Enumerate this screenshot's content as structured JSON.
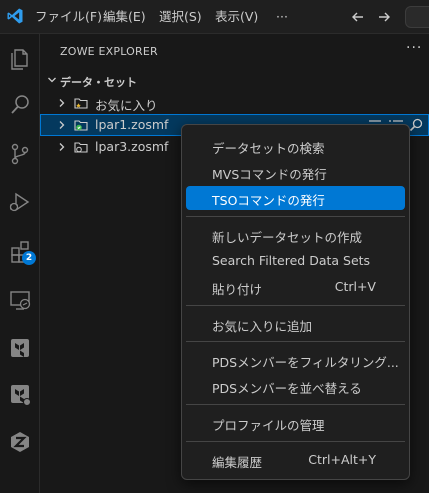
{
  "titlebar": {
    "logo_icon": "vscode-logo-icon",
    "menu": [
      {
        "label": "ファイル(F)"
      },
      {
        "label": "編集(E)"
      },
      {
        "label": "選択(S)"
      },
      {
        "label": "表示(V)"
      },
      {
        "label": "···"
      }
    ],
    "back_icon": "arrow-left-icon",
    "forward_icon": "arrow-right-icon"
  },
  "activity_bar": {
    "items": [
      {
        "icon": "files-icon"
      },
      {
        "icon": "search-icon"
      },
      {
        "icon": "source-control-icon"
      },
      {
        "icon": "run-debug-icon"
      },
      {
        "icon": "extensions-icon",
        "badge": "2"
      },
      {
        "icon": "remote-explorer-icon"
      },
      {
        "icon": "terraform-icon"
      },
      {
        "icon": "terraform-cloud-icon"
      },
      {
        "icon": "zowe-icon"
      }
    ]
  },
  "sidebar": {
    "title": "ZOWE EXPLORER",
    "more": "···",
    "section": {
      "label": "データ・セット"
    },
    "tree": [
      {
        "label": "お気に入り",
        "icon": "favorites-folder-icon"
      },
      {
        "label": "lpar1.zosmf",
        "icon": "connected-profile-icon",
        "selected": true
      },
      {
        "label": "lpar3.zosmf",
        "icon": "profile-icon"
      }
    ]
  },
  "context_menu": {
    "items": [
      {
        "label": "データセットの検索",
        "shortcut": ""
      },
      {
        "label": "MVSコマンドの発行",
        "shortcut": ""
      },
      {
        "label": "TSOコマンドの発行",
        "shortcut": "",
        "active": true
      },
      {
        "label": "新しいデータセットの作成",
        "shortcut": ""
      },
      {
        "label": "Search Filtered Data Sets",
        "shortcut": ""
      },
      {
        "label": "貼り付け",
        "shortcut": "Ctrl+V"
      },
      {
        "label": "お気に入りに追加",
        "shortcut": ""
      },
      {
        "label": "PDSメンバーをフィルタリング...",
        "shortcut": ""
      },
      {
        "label": "PDSメンバーを並べ替える",
        "shortcut": ""
      },
      {
        "label": "プロファイルの管理",
        "shortcut": ""
      },
      {
        "label": "編集履歴",
        "shortcut": "Ctrl+Alt+Y"
      }
    ]
  },
  "colors": {
    "accent": "#0078d4",
    "selection_bg": "#04395e",
    "favorite_star": "#e8b72e",
    "connected_check": "#3fb950"
  }
}
